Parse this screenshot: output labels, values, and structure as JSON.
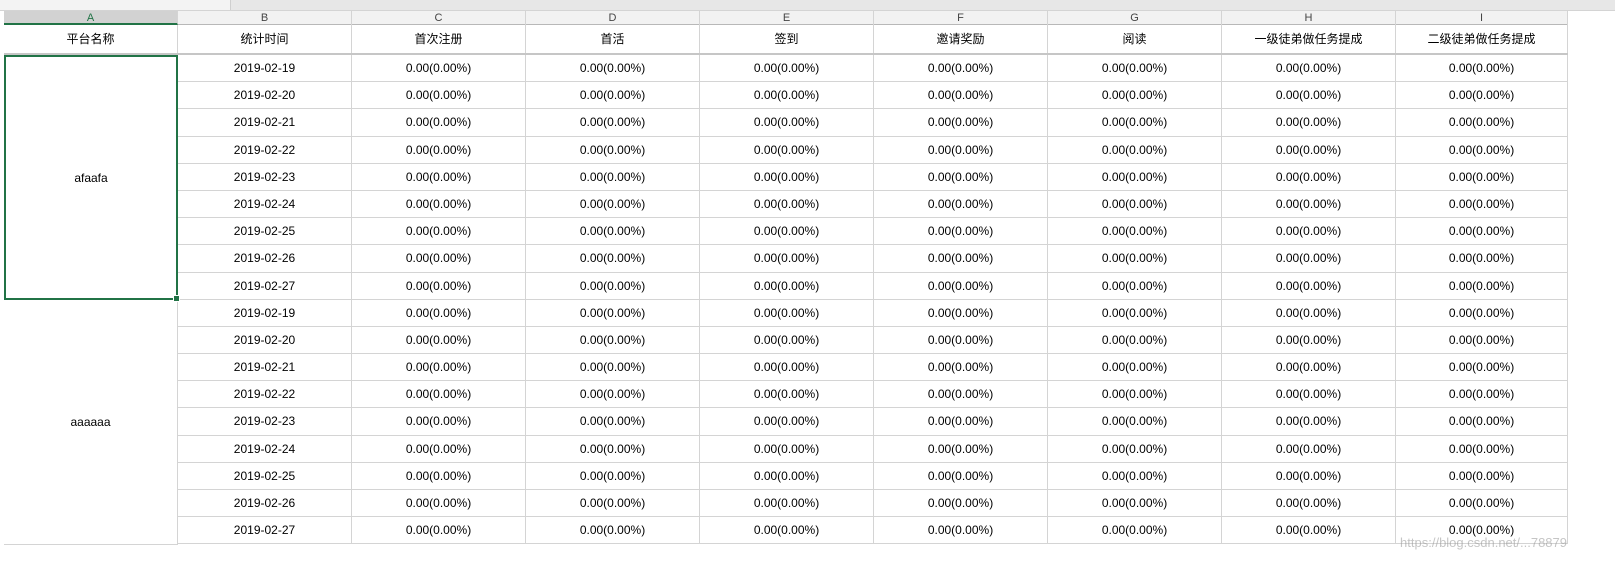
{
  "column_letters": [
    "A",
    "B",
    "C",
    "D",
    "E",
    "F",
    "G",
    "H",
    "I"
  ],
  "headers": [
    "平台名称",
    "统计时间",
    "首次注册",
    "首活",
    "签到",
    "邀请奖励",
    "阅读",
    "一级徒弟做任务提成",
    "二级徒弟做任务提成"
  ],
  "groups": [
    {
      "name": "afaafa",
      "rows": [
        [
          "2019-02-19",
          "0.00(0.00%)",
          "0.00(0.00%)",
          "0.00(0.00%)",
          "0.00(0.00%)",
          "0.00(0.00%)",
          "0.00(0.00%)",
          "0.00(0.00%)"
        ],
        [
          "2019-02-20",
          "0.00(0.00%)",
          "0.00(0.00%)",
          "0.00(0.00%)",
          "0.00(0.00%)",
          "0.00(0.00%)",
          "0.00(0.00%)",
          "0.00(0.00%)"
        ],
        [
          "2019-02-21",
          "0.00(0.00%)",
          "0.00(0.00%)",
          "0.00(0.00%)",
          "0.00(0.00%)",
          "0.00(0.00%)",
          "0.00(0.00%)",
          "0.00(0.00%)"
        ],
        [
          "2019-02-22",
          "0.00(0.00%)",
          "0.00(0.00%)",
          "0.00(0.00%)",
          "0.00(0.00%)",
          "0.00(0.00%)",
          "0.00(0.00%)",
          "0.00(0.00%)"
        ],
        [
          "2019-02-23",
          "0.00(0.00%)",
          "0.00(0.00%)",
          "0.00(0.00%)",
          "0.00(0.00%)",
          "0.00(0.00%)",
          "0.00(0.00%)",
          "0.00(0.00%)"
        ],
        [
          "2019-02-24",
          "0.00(0.00%)",
          "0.00(0.00%)",
          "0.00(0.00%)",
          "0.00(0.00%)",
          "0.00(0.00%)",
          "0.00(0.00%)",
          "0.00(0.00%)"
        ],
        [
          "2019-02-25",
          "0.00(0.00%)",
          "0.00(0.00%)",
          "0.00(0.00%)",
          "0.00(0.00%)",
          "0.00(0.00%)",
          "0.00(0.00%)",
          "0.00(0.00%)"
        ],
        [
          "2019-02-26",
          "0.00(0.00%)",
          "0.00(0.00%)",
          "0.00(0.00%)",
          "0.00(0.00%)",
          "0.00(0.00%)",
          "0.00(0.00%)",
          "0.00(0.00%)"
        ],
        [
          "2019-02-27",
          "0.00(0.00%)",
          "0.00(0.00%)",
          "0.00(0.00%)",
          "0.00(0.00%)",
          "0.00(0.00%)",
          "0.00(0.00%)",
          "0.00(0.00%)"
        ]
      ]
    },
    {
      "name": "aaaaaa",
      "rows": [
        [
          "2019-02-19",
          "0.00(0.00%)",
          "0.00(0.00%)",
          "0.00(0.00%)",
          "0.00(0.00%)",
          "0.00(0.00%)",
          "0.00(0.00%)",
          "0.00(0.00%)"
        ],
        [
          "2019-02-20",
          "0.00(0.00%)",
          "0.00(0.00%)",
          "0.00(0.00%)",
          "0.00(0.00%)",
          "0.00(0.00%)",
          "0.00(0.00%)",
          "0.00(0.00%)"
        ],
        [
          "2019-02-21",
          "0.00(0.00%)",
          "0.00(0.00%)",
          "0.00(0.00%)",
          "0.00(0.00%)",
          "0.00(0.00%)",
          "0.00(0.00%)",
          "0.00(0.00%)"
        ],
        [
          "2019-02-22",
          "0.00(0.00%)",
          "0.00(0.00%)",
          "0.00(0.00%)",
          "0.00(0.00%)",
          "0.00(0.00%)",
          "0.00(0.00%)",
          "0.00(0.00%)"
        ],
        [
          "2019-02-23",
          "0.00(0.00%)",
          "0.00(0.00%)",
          "0.00(0.00%)",
          "0.00(0.00%)",
          "0.00(0.00%)",
          "0.00(0.00%)",
          "0.00(0.00%)"
        ],
        [
          "2019-02-24",
          "0.00(0.00%)",
          "0.00(0.00%)",
          "0.00(0.00%)",
          "0.00(0.00%)",
          "0.00(0.00%)",
          "0.00(0.00%)",
          "0.00(0.00%)"
        ],
        [
          "2019-02-25",
          "0.00(0.00%)",
          "0.00(0.00%)",
          "0.00(0.00%)",
          "0.00(0.00%)",
          "0.00(0.00%)",
          "0.00(0.00%)",
          "0.00(0.00%)"
        ],
        [
          "2019-02-26",
          "0.00(0.00%)",
          "0.00(0.00%)",
          "0.00(0.00%)",
          "0.00(0.00%)",
          "0.00(0.00%)",
          "0.00(0.00%)",
          "0.00(0.00%)"
        ],
        [
          "2019-02-27",
          "0.00(0.00%)",
          "0.00(0.00%)",
          "0.00(0.00%)",
          "0.00(0.00%)",
          "0.00(0.00%)",
          "0.00(0.00%)",
          "0.00(0.00%)"
        ]
      ]
    }
  ],
  "selected_cell": "A",
  "accent_color": "#217346",
  "watermark": "https://blog.csdn.net/...78879"
}
